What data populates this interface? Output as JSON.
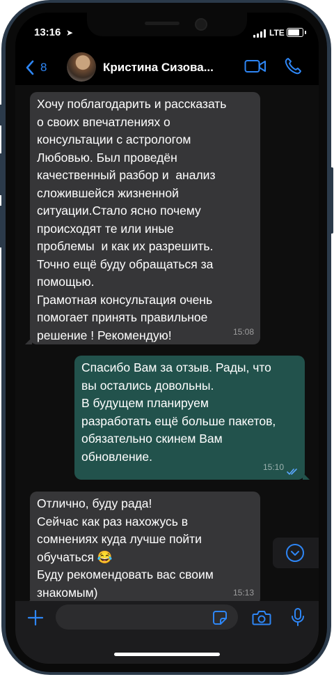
{
  "status": {
    "time": "13:16",
    "network": "LTE"
  },
  "header": {
    "back_count": "8",
    "contact_name": "Кристина Сизова..."
  },
  "messages": [
    {
      "direction": "incoming",
      "text": "Хочу поблагодарить и рассказать\nо своих впечатлениях о\nконсультации с астрологом\nЛюбовью. Был проведён\nкачественный разбор и  анализ\nсложившейся жизненной\nситуации.Стало ясно почему\nпроисходят те или иные\nпроблемы  и как их разрешить.\nТочно ещё буду обращаться за\nпомощью.\nГрамотная консультация очень\nпомогает принять правильное\nрешение ! Рекомендую!",
      "time": "15:08"
    },
    {
      "direction": "outgoing",
      "text": "Спасибо Вам за отзыв. Рады, что\nвы остались довольны.\nВ будущем планируем\nразработать ещё больше пакетов,\nобязательно скинем Вам\nобновление.",
      "time": "15:10",
      "status": "read"
    },
    {
      "direction": "incoming",
      "text": "Отлично, буду рада!\nСейчас как раз нахожусь в\nсомнениях куда лучше пойти\nобучаться 😂\nБуду рекомендовать вас своим\nзнакомым)",
      "time": "15:13"
    }
  ],
  "icons": {
    "back": "chevron-left-icon",
    "video": "video-camera-icon",
    "call": "phone-icon",
    "scroll": "chevron-down-circle-icon",
    "attach": "plus-icon",
    "sticker": "sticker-icon",
    "camera": "camera-icon",
    "mic": "microphone-icon"
  },
  "colors": {
    "accent": "#2e86f5",
    "incoming_bubble": "#363638",
    "outgoing_bubble": "#22524c",
    "read_ticks": "#5aa7ff"
  }
}
